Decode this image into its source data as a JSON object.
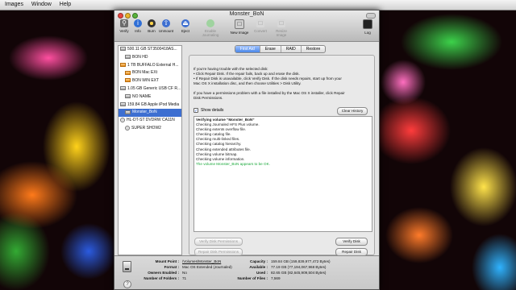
{
  "menubar": {
    "items": [
      "Images",
      "Window",
      "Help"
    ]
  },
  "window": {
    "title": "Monster_BoN"
  },
  "toolbar": {
    "buttons": [
      {
        "label": "Verify",
        "icon": "microscope-icon",
        "enabled": true
      },
      {
        "label": "Info",
        "icon": "info-icon",
        "enabled": true
      },
      {
        "label": "Burn",
        "icon": "burn-icon",
        "enabled": true
      },
      {
        "label": "Unmount",
        "icon": "unmount-icon",
        "enabled": true
      },
      {
        "label": "Eject",
        "icon": "eject-icon",
        "enabled": true
      },
      {
        "label": "Enable Journaling",
        "icon": "journal-icon",
        "enabled": false
      },
      {
        "label": "New Image",
        "icon": "new-image-icon",
        "enabled": true
      },
      {
        "label": "Convert",
        "icon": "convert-icon",
        "enabled": false
      },
      {
        "label": "Resize Image",
        "icon": "resize-icon",
        "enabled": false
      }
    ],
    "log_label": "Log"
  },
  "sidebar": {
    "items": [
      {
        "label": "500.11 GB ST3500418AS...",
        "level": 0,
        "kind": "drive",
        "selected": false
      },
      {
        "label": "BON HD",
        "level": 1,
        "kind": "volume",
        "selected": false
      },
      {
        "label": "1 TB BUFFALO External H...",
        "level": 0,
        "kind": "drive-orange",
        "selected": false
      },
      {
        "label": "BON Mac EXt",
        "level": 1,
        "kind": "volume-orange",
        "selected": false
      },
      {
        "label": "BON WIN EXT",
        "level": 1,
        "kind": "volume-orange",
        "selected": false
      },
      {
        "label": "1.05 GB Generic USB CF R...",
        "level": 0,
        "kind": "drive",
        "selected": false
      },
      {
        "label": "NO NAME",
        "level": 1,
        "kind": "volume",
        "selected": false
      },
      {
        "label": "159.84 GB Apple iPod Media",
        "level": 0,
        "kind": "drive",
        "selected": false
      },
      {
        "label": "Monster_BoN",
        "level": 1,
        "kind": "volume",
        "selected": true
      },
      {
        "label": "HL-DT-ST DVDRW CA11N",
        "level": 0,
        "kind": "disc",
        "selected": false
      },
      {
        "label": "SUPER SHOW2",
        "level": 1,
        "kind": "disc",
        "selected": false
      }
    ]
  },
  "tabs": [
    "First Aid",
    "Erase",
    "RAID",
    "Restore"
  ],
  "first_aid": {
    "instructions": [
      "If you're having trouble with the selected disk:",
      "• Click Repair Disk. If the repair fails, back up and erase the disk.",
      "• If Repair Disk is unavailable, click Verify Disk. If the disk needs repairs, start up from your",
      "   Mac OS X installation disc, and then choose Utilities > Disk Utility.",
      "",
      "If you have a permissions problem with a file installed by the Mac OS X installer, click Repair",
      "Disk Permissions."
    ],
    "show_details_label": "Show details",
    "show_details_checked": true,
    "clear_history_label": "Clear History",
    "log_lines": [
      {
        "text": "Verifying volume “Monster_BoN”",
        "style": "bold"
      },
      {
        "text": "Checking Journaled HFS Plus volume.",
        "style": "normal"
      },
      {
        "text": "Checking extents overflow file.",
        "style": "normal"
      },
      {
        "text": "Checking catalog file.",
        "style": "normal"
      },
      {
        "text": "Checking multi-linked files.",
        "style": "normal"
      },
      {
        "text": "Checking catalog hierarchy.",
        "style": "normal"
      },
      {
        "text": "Checking extended attributes file.",
        "style": "normal"
      },
      {
        "text": "Checking volume bitmap.",
        "style": "normal"
      },
      {
        "text": "Checking volume information.",
        "style": "normal"
      },
      {
        "text": "The volume Monster_BoN appears to be OK.",
        "style": "ok"
      }
    ],
    "verify_permissions_label": "Verify Disk Permissions",
    "repair_permissions_label": "Repair Disk Permissions",
    "verify_disk_label": "Verify Disk",
    "repair_disk_label": "Repair Disk"
  },
  "info": {
    "mount_point_label": "Mount Point :",
    "mount_point": "/Volumes/Monster_BoN",
    "format_label": "Format :",
    "format": "Mac OS Extended (Journaled)",
    "owners_label": "Owners Enabled :",
    "owners": "No",
    "folders_label": "Number of Folders :",
    "folders": "71",
    "capacity_label": "Capacity :",
    "capacity": "159.84 GB (159,839,977,472 Bytes)",
    "available_label": "Available :",
    "available": "77.19 GB (77,194,067,968 Bytes)",
    "used_label": "Used :",
    "used": "82.65 GB (82,645,909,504 Bytes)",
    "files_label": "Number of Files :",
    "files": "7,569"
  }
}
